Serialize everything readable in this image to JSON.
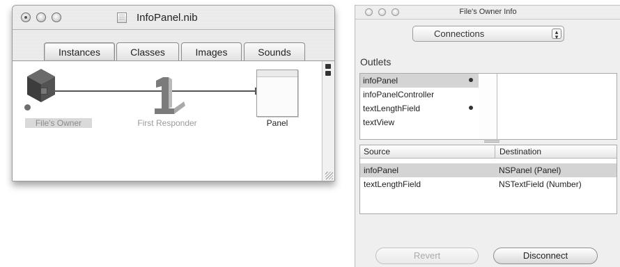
{
  "nib_window": {
    "title": "InfoPanel.nib",
    "tabs": [
      {
        "label": "Instances",
        "active": true
      },
      {
        "label": "Classes",
        "active": false
      },
      {
        "label": "Images",
        "active": false
      },
      {
        "label": "Sounds",
        "active": false
      }
    ],
    "instances": [
      {
        "label": "File's Owner",
        "icon": "cube-icon",
        "selected": true
      },
      {
        "label": "First Responder",
        "icon": "first-responder-icon"
      },
      {
        "label": "Panel",
        "icon": "panel-icon"
      }
    ]
  },
  "info_window": {
    "title": "File's Owner Info",
    "view_popup": {
      "selected": "Connections"
    },
    "outlets_heading": "Outlets",
    "outlets": [
      {
        "name": "infoPanel",
        "connected": true,
        "selected": true
      },
      {
        "name": "infoPanelController",
        "connected": false
      },
      {
        "name": "textLengthField",
        "connected": true
      },
      {
        "name": "textView",
        "connected": false
      }
    ],
    "connections_table": {
      "columns": [
        "Source",
        "Destination"
      ],
      "rows": [
        {
          "source": "infoPanel",
          "destination": "NSPanel (Panel)",
          "selected": true
        },
        {
          "source": "textLengthField",
          "destination": "NSTextField (Number)"
        }
      ]
    },
    "buttons": {
      "revert": "Revert",
      "disconnect": "Disconnect"
    }
  }
}
